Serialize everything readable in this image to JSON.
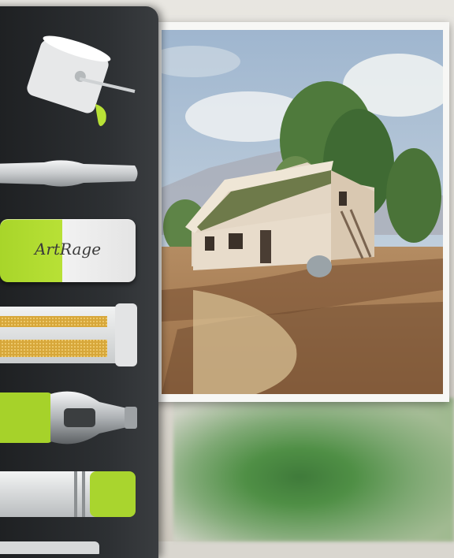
{
  "app": {
    "name": "ArtRage"
  },
  "tools": {
    "eraser_brand": "ArtRage"
  },
  "colors": {
    "palette_bg": "#2d3033",
    "accent_green": "#b8e136",
    "tool_silver": "#d8dadb"
  },
  "icons": [
    "fill-bucket-icon",
    "pen-icon",
    "eraser-icon",
    "glitter-tube-icon",
    "palette-knife-icon",
    "crayon-icon"
  ]
}
